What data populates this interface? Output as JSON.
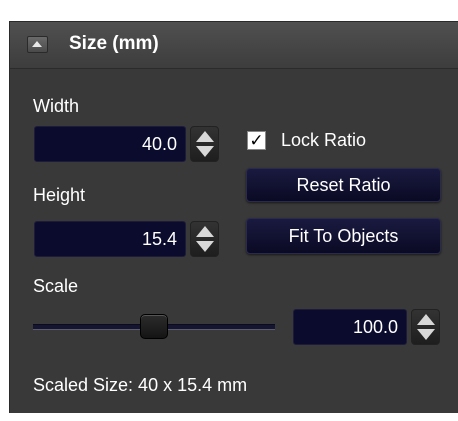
{
  "section": {
    "title": "Size (mm)",
    "collapse_icon": "triangle-up-icon"
  },
  "width": {
    "label": "Width",
    "value": "40.0"
  },
  "height": {
    "label": "Height",
    "value": "15.4"
  },
  "lock_ratio": {
    "label": "Lock Ratio",
    "checked": true,
    "check_glyph": "✓"
  },
  "buttons": {
    "reset_ratio": "Reset Ratio",
    "fit_to_objects": "Fit To Objects"
  },
  "scale": {
    "label": "Scale",
    "value": "100.0",
    "slider_level_fraction": 0.5
  },
  "scaled_size": "Scaled Size: 40 x 15.4 mm",
  "colors": {
    "panel_bg": "#393939",
    "field_bg": "#0b0b2e",
    "text": "#ffffff"
  }
}
